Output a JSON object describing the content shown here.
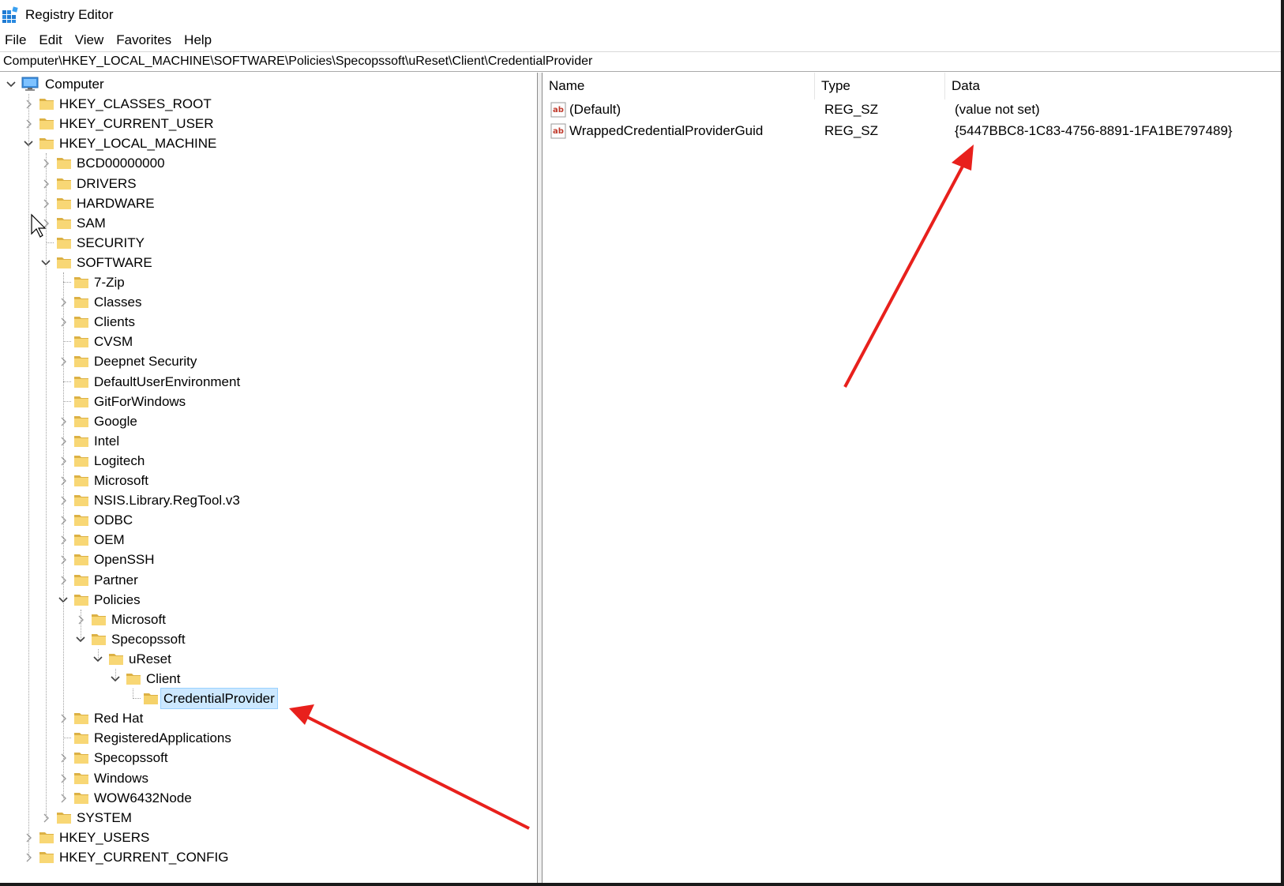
{
  "window": {
    "title": "Registry Editor"
  },
  "menu": [
    "File",
    "Edit",
    "View",
    "Favorites",
    "Help"
  ],
  "address": "Computer\\HKEY_LOCAL_MACHINE\\SOFTWARE\\Policies\\Specopssoft\\uReset\\Client\\CredentialProvider",
  "tree": [
    {
      "label": "Computer",
      "depth": 0,
      "icon": "computer-icon",
      "expander": "expanded"
    },
    {
      "label": "HKEY_CLASSES_ROOT",
      "depth": 1,
      "icon": "folder-icon",
      "expander": "collapsed"
    },
    {
      "label": "HKEY_CURRENT_USER",
      "depth": 1,
      "icon": "folder-icon",
      "expander": "collapsed"
    },
    {
      "label": "HKEY_LOCAL_MACHINE",
      "depth": 1,
      "icon": "folder-icon",
      "expander": "expanded"
    },
    {
      "label": "BCD00000000",
      "depth": 2,
      "icon": "folder-icon",
      "expander": "collapsed"
    },
    {
      "label": "DRIVERS",
      "depth": 2,
      "icon": "folder-icon",
      "expander": "collapsed"
    },
    {
      "label": "HARDWARE",
      "depth": 2,
      "icon": "folder-icon",
      "expander": "collapsed"
    },
    {
      "label": "SAM",
      "depth": 2,
      "icon": "folder-icon",
      "expander": "collapsed"
    },
    {
      "label": "SECURITY",
      "depth": 2,
      "icon": "folder-icon",
      "expander": "none"
    },
    {
      "label": "SOFTWARE",
      "depth": 2,
      "icon": "folder-icon",
      "expander": "expanded"
    },
    {
      "label": "7-Zip",
      "depth": 3,
      "icon": "folder-icon",
      "expander": "none"
    },
    {
      "label": "Classes",
      "depth": 3,
      "icon": "folder-icon",
      "expander": "collapsed"
    },
    {
      "label": "Clients",
      "depth": 3,
      "icon": "folder-icon",
      "expander": "collapsed"
    },
    {
      "label": "CVSM",
      "depth": 3,
      "icon": "folder-icon",
      "expander": "none"
    },
    {
      "label": "Deepnet Security",
      "depth": 3,
      "icon": "folder-icon",
      "expander": "collapsed"
    },
    {
      "label": "DefaultUserEnvironment",
      "depth": 3,
      "icon": "folder-icon",
      "expander": "none"
    },
    {
      "label": "GitForWindows",
      "depth": 3,
      "icon": "folder-icon",
      "expander": "none"
    },
    {
      "label": "Google",
      "depth": 3,
      "icon": "folder-icon",
      "expander": "collapsed"
    },
    {
      "label": "Intel",
      "depth": 3,
      "icon": "folder-icon",
      "expander": "collapsed"
    },
    {
      "label": "Logitech",
      "depth": 3,
      "icon": "folder-icon",
      "expander": "collapsed"
    },
    {
      "label": "Microsoft",
      "depth": 3,
      "icon": "folder-icon",
      "expander": "collapsed"
    },
    {
      "label": "NSIS.Library.RegTool.v3",
      "depth": 3,
      "icon": "folder-icon",
      "expander": "collapsed"
    },
    {
      "label": "ODBC",
      "depth": 3,
      "icon": "folder-icon",
      "expander": "collapsed"
    },
    {
      "label": "OEM",
      "depth": 3,
      "icon": "folder-icon",
      "expander": "collapsed"
    },
    {
      "label": "OpenSSH",
      "depth": 3,
      "icon": "folder-icon",
      "expander": "collapsed"
    },
    {
      "label": "Partner",
      "depth": 3,
      "icon": "folder-icon",
      "expander": "collapsed"
    },
    {
      "label": "Policies",
      "depth": 3,
      "icon": "folder-icon",
      "expander": "expanded"
    },
    {
      "label": "Microsoft",
      "depth": 4,
      "icon": "folder-icon",
      "expander": "collapsed"
    },
    {
      "label": "Specopssoft",
      "depth": 4,
      "icon": "folder-icon",
      "expander": "expanded"
    },
    {
      "label": "uReset",
      "depth": 5,
      "icon": "folder-icon",
      "expander": "expanded"
    },
    {
      "label": "Client",
      "depth": 6,
      "icon": "folder-icon",
      "expander": "expanded"
    },
    {
      "label": "CredentialProvider",
      "depth": 7,
      "icon": "folder-icon",
      "expander": "none",
      "selected": true
    },
    {
      "label": "Red Hat",
      "depth": 3,
      "icon": "folder-icon",
      "expander": "collapsed"
    },
    {
      "label": "RegisteredApplications",
      "depth": 3,
      "icon": "folder-icon",
      "expander": "none"
    },
    {
      "label": "Specopssoft",
      "depth": 3,
      "icon": "folder-icon",
      "expander": "collapsed"
    },
    {
      "label": "Windows",
      "depth": 3,
      "icon": "folder-icon",
      "expander": "collapsed"
    },
    {
      "label": "WOW6432Node",
      "depth": 3,
      "icon": "folder-icon",
      "expander": "collapsed"
    },
    {
      "label": "SYSTEM",
      "depth": 2,
      "icon": "folder-icon",
      "expander": "collapsed"
    },
    {
      "label": "HKEY_USERS",
      "depth": 1,
      "icon": "folder-icon",
      "expander": "collapsed"
    },
    {
      "label": "HKEY_CURRENT_CONFIG",
      "depth": 1,
      "icon": "folder-icon",
      "expander": "collapsed"
    }
  ],
  "list": {
    "columns": [
      "Name",
      "Type",
      "Data"
    ],
    "rows": [
      {
        "icon": "string-value-icon",
        "name": "(Default)",
        "type": "REG_SZ",
        "data": "(value not set)"
      },
      {
        "icon": "string-value-icon",
        "name": "WrappedCredentialProviderGuid",
        "type": "REG_SZ",
        "data": "{5447BBC8-1C83-4756-8891-1FA1BE797489}"
      }
    ]
  },
  "colors": {
    "selection": "#cce8ff",
    "folder": "#f8d775",
    "annotation_arrow": "#e8201c"
  }
}
